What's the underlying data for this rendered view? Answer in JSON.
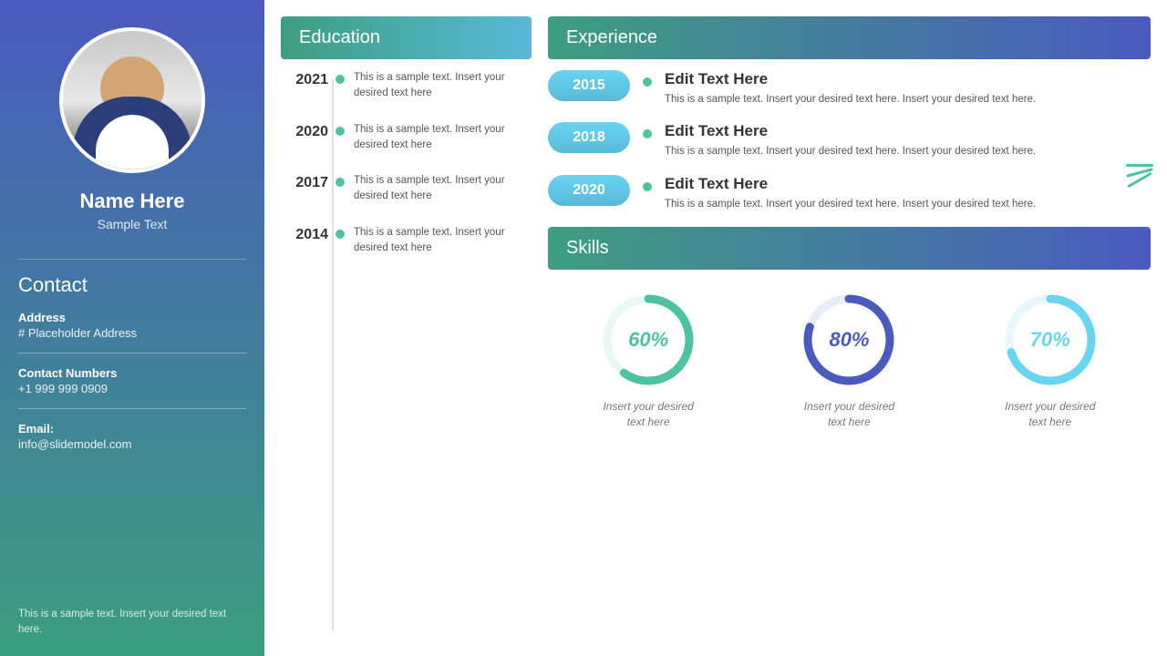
{
  "sidebar": {
    "name": "Name Here",
    "title": "Sample Text",
    "contact_heading": "Contact",
    "address_label": "Address",
    "address_value": "# Placeholder Address",
    "phone_label": "Contact Numbers",
    "phone_value": "+1 999 999 0909",
    "email_label": "Email:",
    "email_value": "info@slidemodel.com",
    "note": "This is a sample text. Insert your desired text here."
  },
  "education": {
    "heading": "Education",
    "items": [
      {
        "year": "2021",
        "text": "This is a sample text. Insert your desired text here"
      },
      {
        "year": "2020",
        "text": "This is a sample text. Insert your desired text here"
      },
      {
        "year": "2017",
        "text": "This is a sample text. Insert your desired text here"
      },
      {
        "year": "2014",
        "text": "This is a sample text. Insert your desired text here"
      }
    ]
  },
  "experience": {
    "heading": "Experience",
    "items": [
      {
        "year": "2015",
        "title": "Edit Text Here",
        "desc": "This is a sample text. Insert your desired text here. Insert your desired text here."
      },
      {
        "year": "2018",
        "title": "Edit Text Here",
        "desc": "This is a sample text. Insert your desired text here. Insert your desired text here."
      },
      {
        "year": "2020",
        "title": "Edit Text Here",
        "desc": "This is a sample text. Insert your desired text here. Insert your desired text here."
      }
    ]
  },
  "skills": {
    "heading": "Skills",
    "items": [
      {
        "percent": 60,
        "label": "Insert your desired\ntext here",
        "color": "#4fc3a1",
        "track": "#e8f8f4"
      },
      {
        "percent": 80,
        "label": "Insert your desired\ntext here",
        "color": "#4a5abf",
        "track": "#eaecf8"
      },
      {
        "percent": 70,
        "label": "Insert your desired\ntext here",
        "color": "#69d5f0",
        "track": "#e8f7fd"
      }
    ]
  }
}
